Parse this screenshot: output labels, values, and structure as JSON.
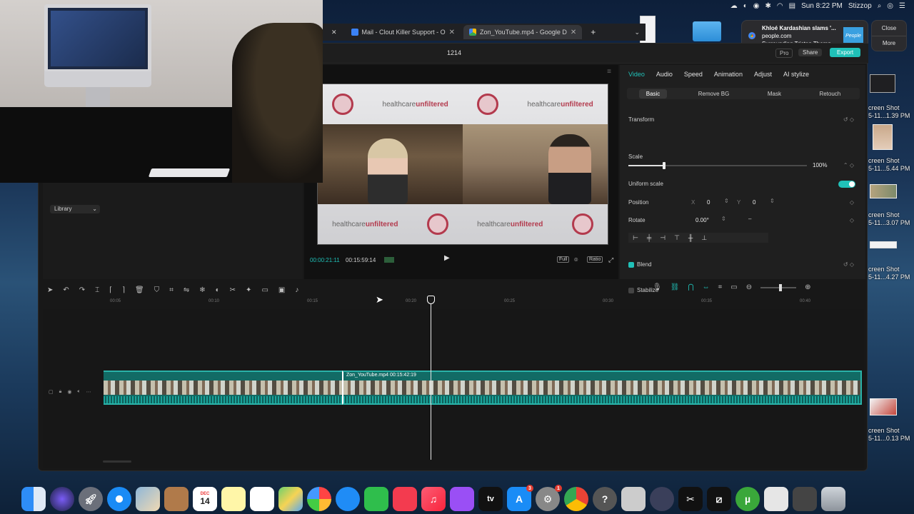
{
  "menubar": {
    "clock": "Sun 8:22 PM",
    "username": "Stizzop"
  },
  "notification": {
    "title": "Khloé Kardashian slams '...",
    "source": "people.com",
    "body": "Surrounding Tristan Thomp...",
    "thumb_text": "People",
    "close_label": "Close",
    "more_label": "More"
  },
  "browser": {
    "tabs": [
      {
        "title": "Mail - Clout Killer Support - O",
        "active": false
      },
      {
        "title": "Zon_YouTube.mp4 - Google D",
        "active": true
      }
    ],
    "new_tab": "+"
  },
  "desktop": {
    "screenshots": [
      {
        "label_1": "creen Shot",
        "label_2": "5-11...1.39 PM"
      },
      {
        "label_1": "creen Shot",
        "label_2": "5-11...5.44 PM"
      },
      {
        "label_1": "creen Shot",
        "label_2": "5-11...3.07 PM"
      },
      {
        "label_1": "creen Shot",
        "label_2": "5-11...4.27 PM"
      },
      {
        "label_1": "creen Shot",
        "label_2": "5-11...0.13 PM"
      }
    ]
  },
  "capcut": {
    "project_name": "1214",
    "pro_label": "Pro",
    "share_label": "Share",
    "export_label": "Export",
    "library_label": "Library",
    "player": {
      "current_time": "00:00:21:11",
      "total_time": "00:15:59:14",
      "ctl_full": "Full",
      "ctl_ratio": "Ratio",
      "banner_brand_plain": "healthcare",
      "banner_brand_bold": "unfiltered"
    },
    "inspector": {
      "tabs": [
        "Video",
        "Audio",
        "Speed",
        "Animation",
        "Adjust",
        "AI stylize"
      ],
      "subtabs": [
        "Basic",
        "Remove BG",
        "Mask",
        "Retouch"
      ],
      "transform_label": "Transform",
      "scale_label": "Scale",
      "scale_value": "100%",
      "scale_fraction": 0.2,
      "uniform_scale_label": "Uniform scale",
      "position_label": "Position",
      "pos_x_label": "X",
      "pos_x": "0",
      "pos_y_label": "Y",
      "pos_y": "0",
      "rotate_label": "Rotate",
      "rotate_value": "0.00°",
      "blend_label": "Blend",
      "stabilize_label": "Stabilize"
    },
    "timeline": {
      "ruler_ticks": [
        "00:05",
        "00:10",
        "00:15",
        "00:20",
        "00:25",
        "00:30",
        "00:35",
        "00:40"
      ],
      "clip_label": "Zon_YouTube.mp4   00:15:42:19"
    }
  },
  "dock": {
    "calendar_day": "14",
    "calendar_month": "DEC",
    "appstore_badge": "3",
    "settings_badge": "1",
    "appletv_label": "tv"
  }
}
